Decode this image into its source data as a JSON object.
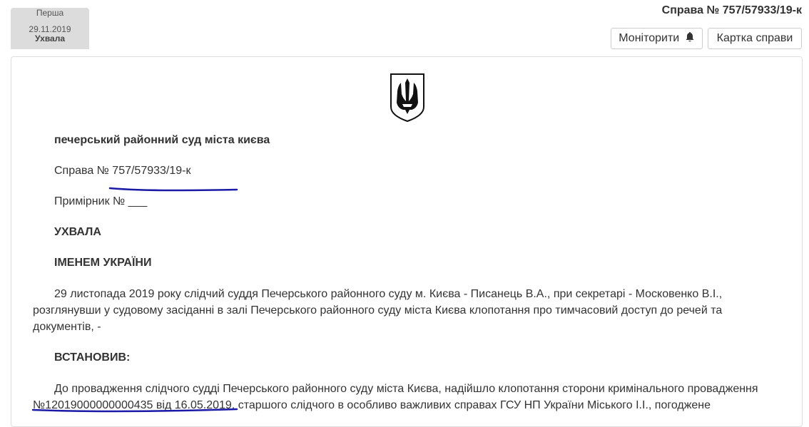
{
  "tab": {
    "instance": "Перша",
    "date": "29.11.2019",
    "type": "Ухвала"
  },
  "header": {
    "case_number": "Справа № 757/57933/19-к",
    "monitor_label": "Моніторити",
    "case_card_label": "Картка справи"
  },
  "document": {
    "court": "печерський районний суд міста києва",
    "case_line": "Справа № 757/57933/19-к",
    "copy_line": "Примірник № ___",
    "decision_type": "УХВАЛА",
    "in_name": "ІМЕНЕМ УКРАЇНИ",
    "paragraph1": "29 листопада 2019 року слідчий суддя Печерського районного суду м. Києва - Писанець В.А., при секретарі - Московенко В.І., розглянувши у судовому засіданні в залі Печерського районного суду міста Києва клопотання про тимчасовий доступ до речей та документів, -",
    "established": "ВСТАНОВИВ:",
    "paragraph2": "До провадження слідчого судді Печерського районного суду міста Києва, надійшло клопотання сторони кримінального провадження №12019000000000435 від 16.05.2019, старшого слідчого в особливо важливих справах ГСУ НП України Міського І.І., погоджене"
  },
  "colors": {
    "ink": "#1a1aa6",
    "tab_bg": "#dcdcdc",
    "border": "#dddddd"
  },
  "icons": {
    "monitor_button": "bell-icon",
    "document_header": "ukraine-trident-emblem-icon"
  }
}
